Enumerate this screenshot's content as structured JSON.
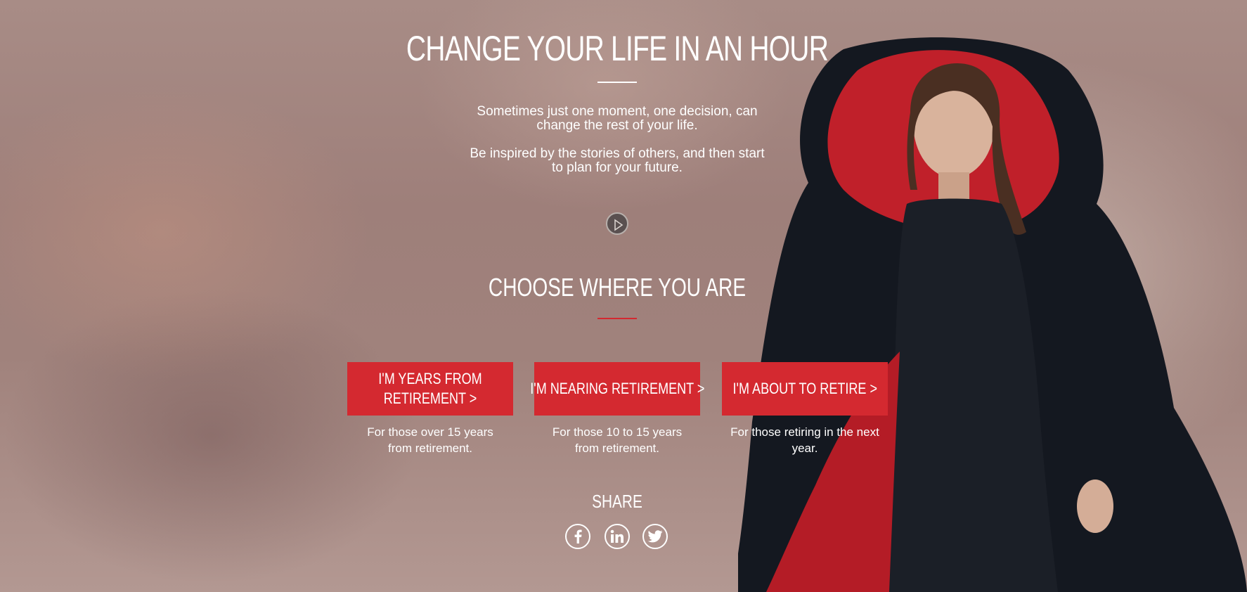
{
  "hero": {
    "title": "CHANGE YOUR LIFE IN AN HOUR",
    "intro_1": "Sometimes just one moment, one decision, can change the rest of your life.",
    "intro_2": "Be inspired by the stories of others, and then start to plan for your future."
  },
  "choose": {
    "heading": "CHOOSE WHERE YOU ARE",
    "options": [
      {
        "label": "I'M YEARS FROM RETIREMENT >",
        "description": "For those over 15 years from retirement."
      },
      {
        "label": "I'M NEARING RETIREMENT >",
        "description": "For those 10 to 15 years from retirement."
      },
      {
        "label": "I'M ABOUT TO RETIRE >",
        "description": "For those retiring in the next year."
      }
    ]
  },
  "share": {
    "label": "SHARE",
    "icons": [
      "facebook-icon",
      "linkedin-icon",
      "twitter-icon"
    ]
  },
  "colors": {
    "accent": "#d42930",
    "text": "#ffffff"
  }
}
